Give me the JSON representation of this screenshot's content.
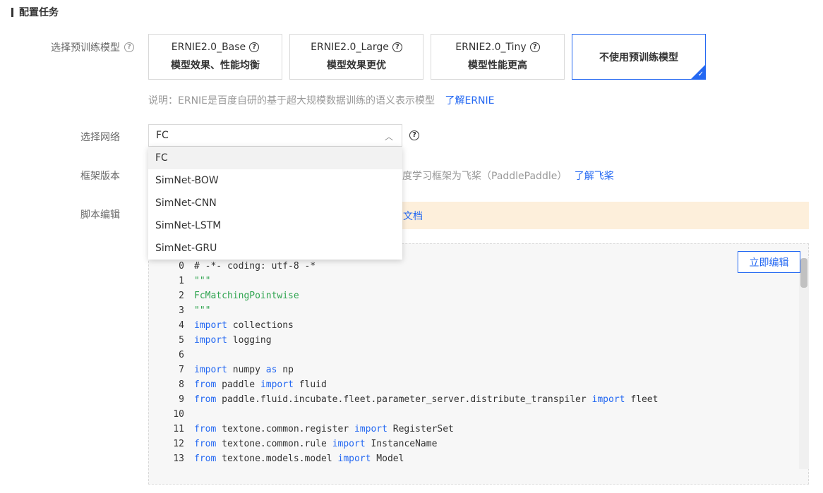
{
  "section": {
    "title": "配置任务"
  },
  "pretrain": {
    "label": "选择预训练模型",
    "cards": [
      {
        "name": "ERNIE2.0_Base",
        "desc": "模型效果、性能均衡",
        "selected": false
      },
      {
        "name": "ERNIE2.0_Large",
        "desc": "模型效果更优",
        "selected": false
      },
      {
        "name": "ERNIE2.0_Tiny",
        "desc": "模型性能更高",
        "selected": false
      },
      {
        "name": "不使用预训练模型",
        "desc": "",
        "selected": true
      }
    ],
    "note": "说明：ERNIE是百度自研的基于超大规模数据训练的语义表示模型",
    "note_link": "了解ERNIE"
  },
  "network": {
    "label": "选择网络",
    "selected": "FC",
    "options": [
      "FC",
      "SimNet-BOW",
      "SimNet-CNN",
      "SimNet-LSTM",
      "SimNet-GRU"
    ]
  },
  "framework": {
    "label": "框架版本",
    "note": "度学习框架为飞桨（PaddlePaddle）",
    "link": "了解飞桨"
  },
  "script": {
    "label": "脚本编辑",
    "notice_link": "文档",
    "edit_button": "立即编辑",
    "lines": [
      {
        "n": "0",
        "t": "# -*- coding: utf-8 -*"
      },
      {
        "n": "1",
        "t": "\"\"\""
      },
      {
        "n": "2",
        "t": "FcMatchingPointwise"
      },
      {
        "n": "3",
        "t": "\"\"\""
      },
      {
        "n": "4",
        "t": "import collections"
      },
      {
        "n": "5",
        "t": "import logging"
      },
      {
        "n": "6",
        "t": ""
      },
      {
        "n": "7",
        "t": "import numpy as np"
      },
      {
        "n": "8",
        "t": "from paddle import fluid"
      },
      {
        "n": "9",
        "t": "from paddle.fluid.incubate.fleet.parameter_server.distribute_transpiler import fleet"
      },
      {
        "n": "10",
        "t": ""
      },
      {
        "n": "11",
        "t": "from textone.common.register import RegisterSet"
      },
      {
        "n": "12",
        "t": "from textone.common.rule import InstanceName"
      },
      {
        "n": "13",
        "t": "from textone.models.model import Model"
      }
    ]
  },
  "colors": {
    "accent": "#2468f2",
    "notice_bg": "#fdefdb",
    "string": "#2ea44f"
  },
  "icons": {
    "help": "question-circle-icon",
    "chevron": "chevron-up-icon",
    "check": "check-icon"
  }
}
